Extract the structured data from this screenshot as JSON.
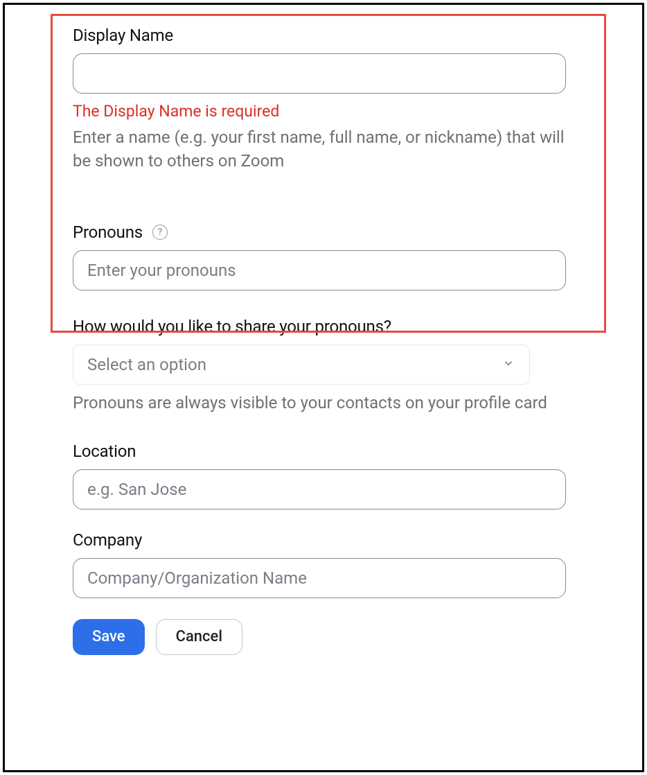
{
  "displayName": {
    "label": "Display Name",
    "value": "",
    "error": "The Display Name is required",
    "help": "Enter a name (e.g. your first name, full name, or nickname) that will be shown to others on Zoom"
  },
  "pronouns": {
    "label": "Pronouns",
    "placeholder": "Enter your pronouns",
    "value": ""
  },
  "pronounsShare": {
    "label": "How would you like to share your pronouns?",
    "placeholder": "Select an option",
    "help": "Pronouns are always visible to your contacts on your profile card"
  },
  "location": {
    "label": "Location",
    "placeholder": "e.g. San Jose",
    "value": ""
  },
  "company": {
    "label": "Company",
    "placeholder": "Company/Organization Name",
    "value": ""
  },
  "buttons": {
    "save": "Save",
    "cancel": "Cancel"
  }
}
